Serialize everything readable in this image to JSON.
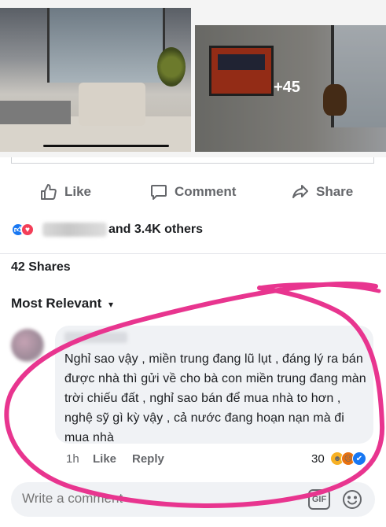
{
  "photos": {
    "more_count": "+45"
  },
  "actions": {
    "like": "Like",
    "comment": "Comment",
    "share": "Share"
  },
  "reactions": {
    "others_text": "and 3.4K others"
  },
  "shares": {
    "label": "42 Shares"
  },
  "sort": {
    "label": "Most Relevant"
  },
  "comment": {
    "text": "Nghỉ sao vậy , miền trung đang lũ lụt , đáng lý ra bán được nhà thì gửi về cho bà con miền trung đang màn trời chiếu đất , nghỉ sao bán để mua nhà to hơn , nghệ sỹ gì kỳ vậy , cả nước đang hoạn nạn mà đi mua nhà",
    "time": "1h",
    "like": "Like",
    "reply": "Reply",
    "reaction_count": "30"
  },
  "composer": {
    "placeholder": "Write a comment",
    "gif_label": "GIF"
  },
  "colors": {
    "facebook_blue": "#1877f2",
    "love_red": "#f33e58",
    "annotation_pink": "#e8358f",
    "muted_text": "#65676b"
  },
  "icons": {
    "like": "thumbs-up-icon",
    "comment": "speech-bubble-icon",
    "share": "share-arrow-icon",
    "emoji": "smiley-icon"
  }
}
